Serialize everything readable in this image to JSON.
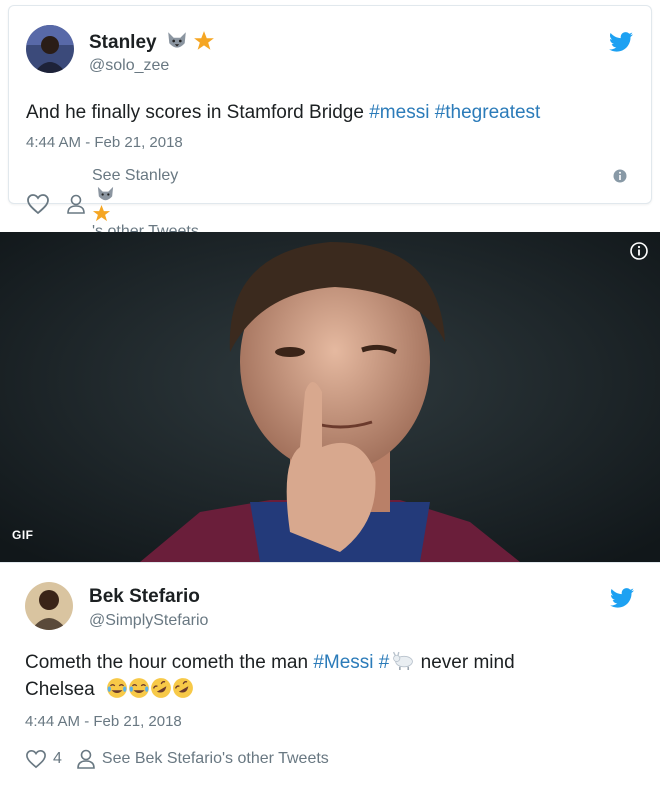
{
  "tweets": [
    {
      "name": "Stanley",
      "handle": "@solo_zee",
      "text_prefix": "And he finally scores in Stamford Bridge ",
      "hashtags": [
        "#messi",
        "#thegreatest"
      ],
      "timestamp": "4:44 AM - Feb 21, 2018",
      "see_prefix": "See Stanley",
      "see_suffix": "'s other Tweets",
      "like_count": ""
    },
    {
      "name": "Bek Stefario",
      "handle": "@SimplyStefario",
      "text_part1": "Cometh the hour cometh the man ",
      "hashtag": "#Messi",
      "hash_symbol": " #",
      "text_part2": " never mind",
      "text_line2": "Chelsea",
      "timestamp": "4:44 AM - Feb 21, 2018",
      "like_count": "4",
      "see_text": "See Bek Stefario's other Tweets"
    }
  ],
  "media": {
    "badge": "GIF"
  },
  "colors": {
    "twitter_blue": "#1da1f2",
    "hashtag": "#2b7bb9",
    "meta_gray": "#697882"
  }
}
